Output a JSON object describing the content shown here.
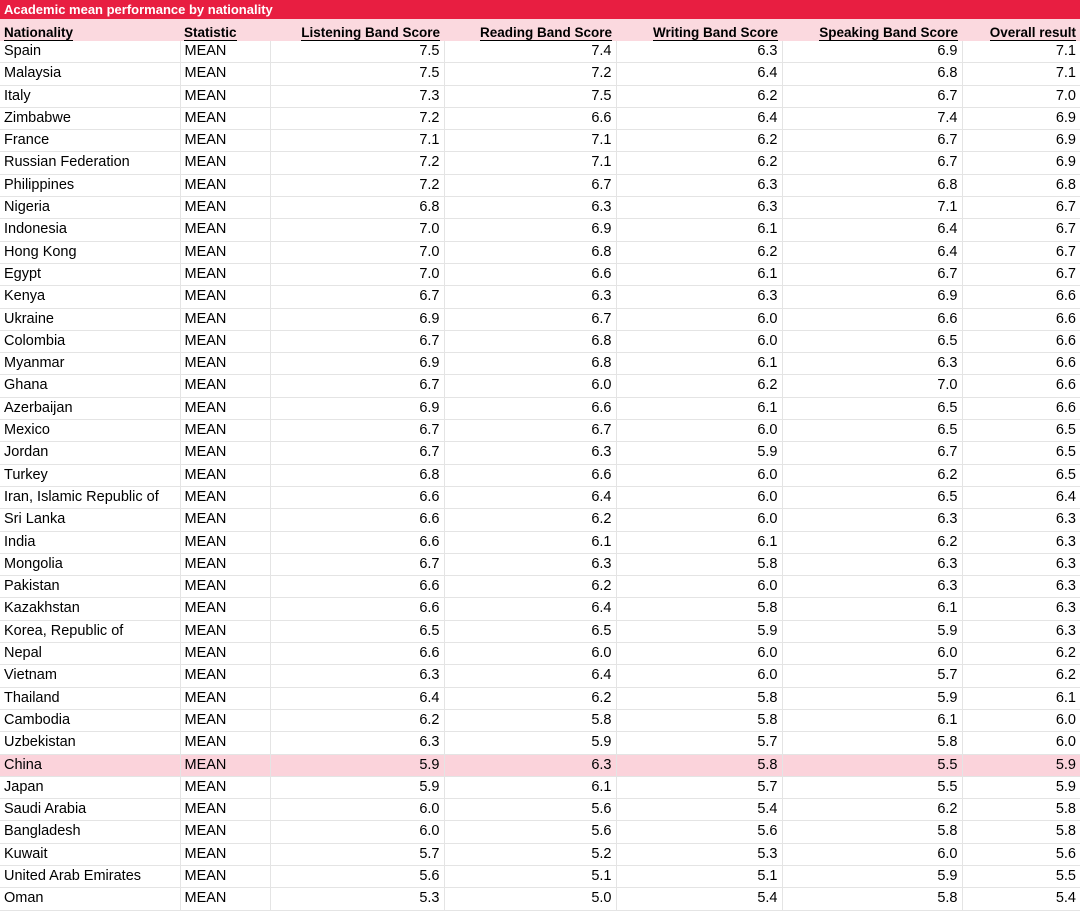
{
  "title": "Academic mean performance by nationality",
  "colors": {
    "title_bar_background": "#e81e41",
    "title_bar_text": "#ffffff",
    "header_background": "#fbd9df",
    "highlight_row_background": "#fbd3db",
    "grid_line": "#e4e4e4",
    "text": "#000000"
  },
  "columns": [
    {
      "key": "nationality",
      "label": "Nationality",
      "align": "left"
    },
    {
      "key": "statistic",
      "label": "Statistic",
      "align": "left"
    },
    {
      "key": "listening",
      "label": "Listening Band Score",
      "align": "right"
    },
    {
      "key": "reading",
      "label": "Reading Band Score",
      "align": "right"
    },
    {
      "key": "writing",
      "label": "Writing Band Score",
      "align": "right"
    },
    {
      "key": "speaking",
      "label": "Speaking Band Score",
      "align": "right"
    },
    {
      "key": "overall",
      "label": "Overall result",
      "align": "right"
    }
  ],
  "header": {
    "nationality": "Nationality",
    "statistic": "Statistic",
    "listening": "Listening Band Score",
    "reading": "Reading Band Score",
    "writing": "Writing Band Score",
    "speaking": "Speaking Band Score",
    "overall": "Overall result"
  },
  "highlighted_nationality": "China",
  "rows": [
    {
      "nationality": "Spain",
      "statistic": "MEAN",
      "listening": "7.5",
      "reading": "7.4",
      "writing": "6.3",
      "speaking": "6.9",
      "overall": "7.1",
      "highlight": false
    },
    {
      "nationality": "Malaysia",
      "statistic": "MEAN",
      "listening": "7.5",
      "reading": "7.2",
      "writing": "6.4",
      "speaking": "6.8",
      "overall": "7.1",
      "highlight": false
    },
    {
      "nationality": "Italy",
      "statistic": "MEAN",
      "listening": "7.3",
      "reading": "7.5",
      "writing": "6.2",
      "speaking": "6.7",
      "overall": "7.0",
      "highlight": false
    },
    {
      "nationality": "Zimbabwe",
      "statistic": "MEAN",
      "listening": "7.2",
      "reading": "6.6",
      "writing": "6.4",
      "speaking": "7.4",
      "overall": "6.9",
      "highlight": false
    },
    {
      "nationality": "France",
      "statistic": "MEAN",
      "listening": "7.1",
      "reading": "7.1",
      "writing": "6.2",
      "speaking": "6.7",
      "overall": "6.9",
      "highlight": false
    },
    {
      "nationality": "Russian Federation",
      "statistic": "MEAN",
      "listening": "7.2",
      "reading": "7.1",
      "writing": "6.2",
      "speaking": "6.7",
      "overall": "6.9",
      "highlight": false
    },
    {
      "nationality": "Philippines",
      "statistic": "MEAN",
      "listening": "7.2",
      "reading": "6.7",
      "writing": "6.3",
      "speaking": "6.8",
      "overall": "6.8",
      "highlight": false
    },
    {
      "nationality": "Nigeria",
      "statistic": "MEAN",
      "listening": "6.8",
      "reading": "6.3",
      "writing": "6.3",
      "speaking": "7.1",
      "overall": "6.7",
      "highlight": false
    },
    {
      "nationality": "Indonesia",
      "statistic": "MEAN",
      "listening": "7.0",
      "reading": "6.9",
      "writing": "6.1",
      "speaking": "6.4",
      "overall": "6.7",
      "highlight": false
    },
    {
      "nationality": "Hong Kong",
      "statistic": "MEAN",
      "listening": "7.0",
      "reading": "6.8",
      "writing": "6.2",
      "speaking": "6.4",
      "overall": "6.7",
      "highlight": false
    },
    {
      "nationality": "Egypt",
      "statistic": "MEAN",
      "listening": "7.0",
      "reading": "6.6",
      "writing": "6.1",
      "speaking": "6.7",
      "overall": "6.7",
      "highlight": false
    },
    {
      "nationality": "Kenya",
      "statistic": "MEAN",
      "listening": "6.7",
      "reading": "6.3",
      "writing": "6.3",
      "speaking": "6.9",
      "overall": "6.6",
      "highlight": false
    },
    {
      "nationality": "Ukraine",
      "statistic": "MEAN",
      "listening": "6.9",
      "reading": "6.7",
      "writing": "6.0",
      "speaking": "6.6",
      "overall": "6.6",
      "highlight": false
    },
    {
      "nationality": "Colombia",
      "statistic": "MEAN",
      "listening": "6.7",
      "reading": "6.8",
      "writing": "6.0",
      "speaking": "6.5",
      "overall": "6.6",
      "highlight": false
    },
    {
      "nationality": "Myanmar",
      "statistic": "MEAN",
      "listening": "6.9",
      "reading": "6.8",
      "writing": "6.1",
      "speaking": "6.3",
      "overall": "6.6",
      "highlight": false
    },
    {
      "nationality": "Ghana",
      "statistic": "MEAN",
      "listening": "6.7",
      "reading": "6.0",
      "writing": "6.2",
      "speaking": "7.0",
      "overall": "6.6",
      "highlight": false
    },
    {
      "nationality": "Azerbaijan",
      "statistic": "MEAN",
      "listening": "6.9",
      "reading": "6.6",
      "writing": "6.1",
      "speaking": "6.5",
      "overall": "6.6",
      "highlight": false
    },
    {
      "nationality": "Mexico",
      "statistic": "MEAN",
      "listening": "6.7",
      "reading": "6.7",
      "writing": "6.0",
      "speaking": "6.5",
      "overall": "6.5",
      "highlight": false
    },
    {
      "nationality": "Jordan",
      "statistic": "MEAN",
      "listening": "6.7",
      "reading": "6.3",
      "writing": "5.9",
      "speaking": "6.7",
      "overall": "6.5",
      "highlight": false
    },
    {
      "nationality": "Turkey",
      "statistic": "MEAN",
      "listening": "6.8",
      "reading": "6.6",
      "writing": "6.0",
      "speaking": "6.2",
      "overall": "6.5",
      "highlight": false
    },
    {
      "nationality": "Iran, Islamic Republic of",
      "statistic": "MEAN",
      "listening": "6.6",
      "reading": "6.4",
      "writing": "6.0",
      "speaking": "6.5",
      "overall": "6.4",
      "highlight": false
    },
    {
      "nationality": "Sri Lanka",
      "statistic": "MEAN",
      "listening": "6.6",
      "reading": "6.2",
      "writing": "6.0",
      "speaking": "6.3",
      "overall": "6.3",
      "highlight": false
    },
    {
      "nationality": "India",
      "statistic": "MEAN",
      "listening": "6.6",
      "reading": "6.1",
      "writing": "6.1",
      "speaking": "6.2",
      "overall": "6.3",
      "highlight": false
    },
    {
      "nationality": "Mongolia",
      "statistic": "MEAN",
      "listening": "6.7",
      "reading": "6.3",
      "writing": "5.8",
      "speaking": "6.3",
      "overall": "6.3",
      "highlight": false
    },
    {
      "nationality": "Pakistan",
      "statistic": "MEAN",
      "listening": "6.6",
      "reading": "6.2",
      "writing": "6.0",
      "speaking": "6.3",
      "overall": "6.3",
      "highlight": false
    },
    {
      "nationality": "Kazakhstan",
      "statistic": "MEAN",
      "listening": "6.6",
      "reading": "6.4",
      "writing": "5.8",
      "speaking": "6.1",
      "overall": "6.3",
      "highlight": false
    },
    {
      "nationality": "Korea, Republic of",
      "statistic": "MEAN",
      "listening": "6.5",
      "reading": "6.5",
      "writing": "5.9",
      "speaking": "5.9",
      "overall": "6.3",
      "highlight": false
    },
    {
      "nationality": "Nepal",
      "statistic": "MEAN",
      "listening": "6.6",
      "reading": "6.0",
      "writing": "6.0",
      "speaking": "6.0",
      "overall": "6.2",
      "highlight": false
    },
    {
      "nationality": "Vietnam",
      "statistic": "MEAN",
      "listening": "6.3",
      "reading": "6.4",
      "writing": "6.0",
      "speaking": "5.7",
      "overall": "6.2",
      "highlight": false
    },
    {
      "nationality": "Thailand",
      "statistic": "MEAN",
      "listening": "6.4",
      "reading": "6.2",
      "writing": "5.8",
      "speaking": "5.9",
      "overall": "6.1",
      "highlight": false
    },
    {
      "nationality": "Cambodia",
      "statistic": "MEAN",
      "listening": "6.2",
      "reading": "5.8",
      "writing": "5.8",
      "speaking": "6.1",
      "overall": "6.0",
      "highlight": false
    },
    {
      "nationality": "Uzbekistan",
      "statistic": "MEAN",
      "listening": "6.3",
      "reading": "5.9",
      "writing": "5.7",
      "speaking": "5.8",
      "overall": "6.0",
      "highlight": false
    },
    {
      "nationality": "China",
      "statistic": "MEAN",
      "listening": "5.9",
      "reading": "6.3",
      "writing": "5.8",
      "speaking": "5.5",
      "overall": "5.9",
      "highlight": true
    },
    {
      "nationality": "Japan",
      "statistic": "MEAN",
      "listening": "5.9",
      "reading": "6.1",
      "writing": "5.7",
      "speaking": "5.5",
      "overall": "5.9",
      "highlight": false
    },
    {
      "nationality": "Saudi Arabia",
      "statistic": "MEAN",
      "listening": "6.0",
      "reading": "5.6",
      "writing": "5.4",
      "speaking": "6.2",
      "overall": "5.8",
      "highlight": false
    },
    {
      "nationality": "Bangladesh",
      "statistic": "MEAN",
      "listening": "6.0",
      "reading": "5.6",
      "writing": "5.6",
      "speaking": "5.8",
      "overall": "5.8",
      "highlight": false
    },
    {
      "nationality": "Kuwait",
      "statistic": "MEAN",
      "listening": "5.7",
      "reading": "5.2",
      "writing": "5.3",
      "speaking": "6.0",
      "overall": "5.6",
      "highlight": false
    },
    {
      "nationality": "United Arab Emirates",
      "statistic": "MEAN",
      "listening": "5.6",
      "reading": "5.1",
      "writing": "5.1",
      "speaking": "5.9",
      "overall": "5.5",
      "highlight": false
    },
    {
      "nationality": "Oman",
      "statistic": "MEAN",
      "listening": "5.3",
      "reading": "5.0",
      "writing": "5.4",
      "speaking": "5.8",
      "overall": "5.4",
      "highlight": false
    }
  ]
}
